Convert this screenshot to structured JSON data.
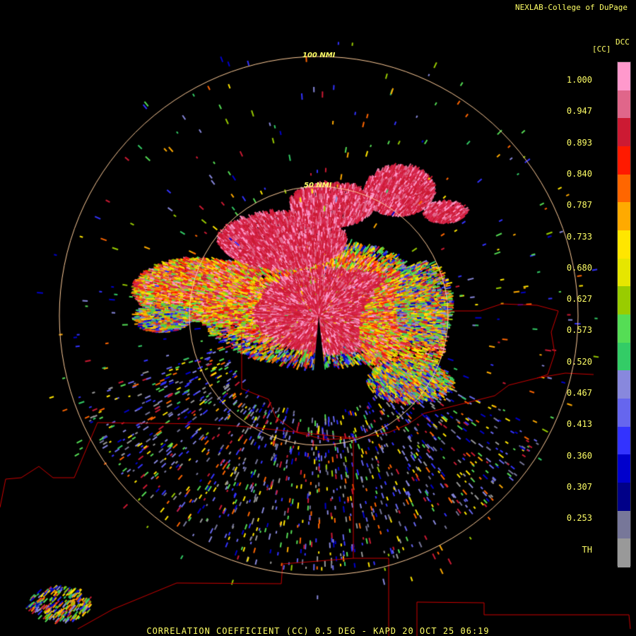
{
  "credit": "NEXLAB-College of DuPage",
  "product": {
    "footer": "CORRELATION COEFFICIENT (CC) 0.5 DEG - KAPD 20 OCT 25 06:19",
    "rings": [
      "100 NMI",
      "50 NMI"
    ]
  },
  "legend": {
    "abbr": "DCC",
    "unit": "[CC]",
    "ticks": [
      "1.000",
      "0.947",
      "0.893",
      "0.840",
      "0.787",
      "0.733",
      "0.680",
      "0.627",
      "0.573",
      "0.520",
      "0.467",
      "0.413",
      "0.360",
      "0.307",
      "0.253",
      "TH"
    ],
    "colors": [
      "#ff99cc",
      "#e0668a",
      "#cc1a33",
      "#ff1a00",
      "#ff6600",
      "#ffaa00",
      "#ffe600",
      "#e6e600",
      "#99cc00",
      "#55dd55",
      "#33cc66",
      "#8888dd",
      "#6666ee",
      "#3333ff",
      "#0000cc",
      "#000088",
      "#777799",
      "#999999"
    ]
  },
  "colors": {
    "text": "#ffff66",
    "rings": "#ffcc99",
    "borders": "#cc0000",
    "background": "#000000"
  }
}
